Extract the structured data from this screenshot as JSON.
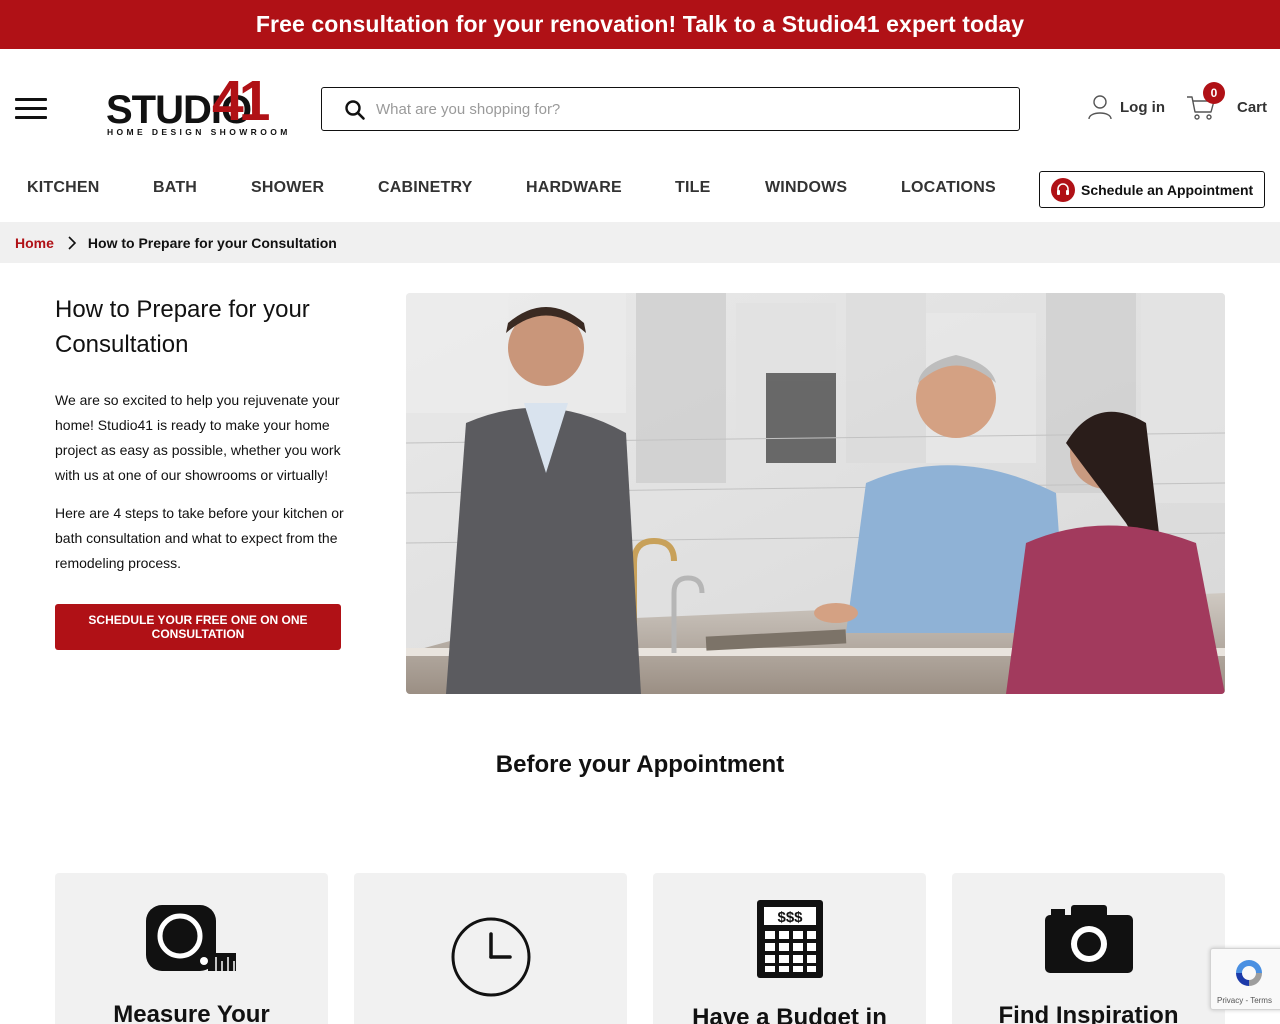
{
  "promo_banner": "Free consultation for your renovation! Talk to a Studio41 expert today",
  "logo": {
    "word": "STUDIO",
    "num": "41",
    "sub": "HOME DESIGN SHOWROOM"
  },
  "search": {
    "placeholder": "What are you shopping for?",
    "value": ""
  },
  "header": {
    "login_label": "Log in",
    "cart_label": "Cart",
    "cart_count": "0"
  },
  "nav": {
    "items": [
      "KITCHEN",
      "BATH",
      "SHOWER",
      "CABINETRY",
      "HARDWARE",
      "TILE",
      "WINDOWS",
      "LOCATIONS"
    ],
    "appointment_label": "Schedule an Appointment"
  },
  "breadcrumb": {
    "home": "Home",
    "current": "How to Prepare for your Consultation"
  },
  "intro": {
    "title": "How to Prepare for your Consultation",
    "paragraph1": "We are so excited to help you rejuvenate your home! Studio41 is ready to make your home project as easy as possible, whether you work with us at one of our showrooms or virtually!",
    "paragraph2": "Here are 4 steps to take before your kitchen or bath consultation and what to expect from the remodeling process.",
    "cta_label": "SCHEDULE YOUR FREE ONE ON ONE CONSULTATION"
  },
  "section_title": "Before your Appointment",
  "cards": [
    {
      "icon": "tape-measure-icon",
      "title": "Measure Your"
    },
    {
      "icon": "clock-icon",
      "title": ""
    },
    {
      "icon": "calculator-icon",
      "title": "Have a Budget in"
    },
    {
      "icon": "camera-icon",
      "title": "Find Inspiration"
    }
  ],
  "recaptcha": {
    "text": "Privacy - Terms"
  },
  "colors": {
    "brand_red": "#b01116",
    "breadcrumb_bg": "#f0f0f0",
    "card_bg": "#f1f1f1"
  }
}
